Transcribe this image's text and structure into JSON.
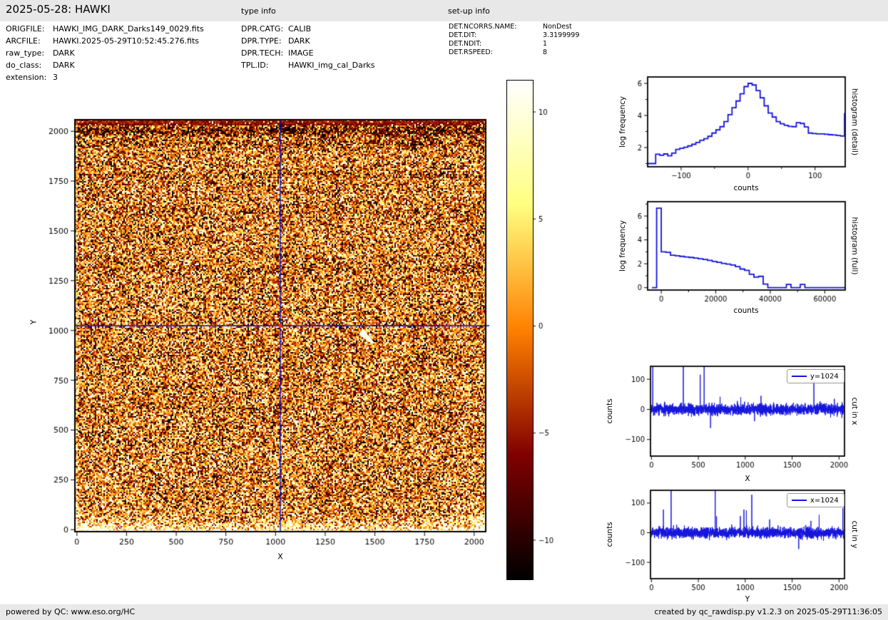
{
  "header": {
    "title": "2025-05-28: HAWKI",
    "type_info_heading": "type info",
    "setup_info_heading": "set-up info"
  },
  "file_info": {
    "rows": [
      {
        "label": "ORIGFILE:",
        "value": "HAWKI_IMG_DARK_Darks149_0029.fits"
      },
      {
        "label": "ARCFILE:",
        "value": "HAWKI.2025-05-29T10:52:45.276.fits"
      },
      {
        "label": "raw_type:",
        "value": "DARK"
      },
      {
        "label": "do_class:",
        "value": "DARK"
      },
      {
        "label": "extension:",
        "value": "3"
      }
    ]
  },
  "type_info": {
    "rows": [
      {
        "label": "DPR.CATG:",
        "value": "CALIB"
      },
      {
        "label": "DPR.TYPE:",
        "value": "DARK"
      },
      {
        "label": "DPR.TECH:",
        "value": "IMAGE"
      },
      {
        "label": "TPL.ID:",
        "value": "HAWKI_img_cal_Darks"
      }
    ]
  },
  "setup_info": {
    "rows": [
      {
        "label": "DET.NCORRS.NAME:",
        "value": "NonDest"
      },
      {
        "label": "DET.DIT:",
        "value": "3.3199999"
      },
      {
        "label": "DET.NDIT:",
        "value": "1"
      },
      {
        "label": "DET.RSPEED:",
        "value": "8"
      }
    ]
  },
  "footer": {
    "left": "powered by QC: www.eso.org/HC",
    "right": "created by qc_rawdisp.py v1.2.3 on 2025-05-29T11:36:05"
  },
  "colors": {
    "line_blue": "#1414dc",
    "crosshair_blue": "#0000cd",
    "marker_red": "#f03000",
    "header_bg": "#e8e8e8",
    "footer_bg": "#e9e9e9",
    "streak_white": "#fffdf2"
  },
  "chart_data": [
    {
      "id": "main_image",
      "type": "heatmap",
      "xlabel": "X",
      "ylabel": "Y",
      "xlim": [
        -10,
        2058
      ],
      "ylim": [
        -10,
        2058
      ],
      "xticks_major": [
        0,
        250,
        500,
        750,
        1000,
        1250,
        1500,
        1750,
        2000
      ],
      "yticks_major": [
        0,
        250,
        500,
        750,
        1000,
        1250,
        1500,
        1750,
        2000
      ],
      "colormap": "afmhot",
      "vmin": -11.8,
      "vmax": 11.5,
      "crosshair": {
        "x": 1024,
        "y": 1024
      },
      "streak": {
        "x": 1460,
        "y": 965
      },
      "description": "2048x2048 HAWKI dark frame: orange/red speckle noise, dark band at top rows, bright white band at bottom rows curving up in corners, blue crosshair lines at x=1024 and y=1024 with red marker, white cosmic-ray streak near (1460,965)"
    },
    {
      "id": "colorbar",
      "type": "colorbar",
      "vmin": -11.8,
      "vmax": 11.5,
      "ticks": [
        10,
        5,
        0,
        -5,
        -10
      ]
    },
    {
      "id": "histogram_detail",
      "type": "bar",
      "side_label": "histogram (detail)",
      "xlabel": "counts",
      "ylabel": "log frequency",
      "xlim": [
        -150,
        145
      ],
      "ylim": [
        0.8,
        6.4
      ],
      "xticks_major": [
        -100,
        0,
        100
      ],
      "xticks_minor": [
        -50,
        50
      ],
      "yticks_major": [
        2,
        4,
        6
      ],
      "yticks_minor": [
        1,
        3,
        5
      ],
      "x_start": -150,
      "bin_width": 6,
      "values": [
        1.0,
        1.0,
        1.58,
        1.52,
        1.6,
        1.48,
        1.65,
        1.88,
        1.95,
        2.02,
        2.1,
        2.2,
        2.32,
        2.45,
        2.55,
        2.7,
        2.9,
        3.1,
        3.3,
        3.62,
        4.05,
        4.48,
        4.9,
        5.35,
        5.8,
        6.0,
        5.9,
        5.55,
        5.1,
        4.6,
        4.15,
        3.9,
        3.62,
        3.48,
        3.38,
        3.32,
        3.3,
        3.55,
        3.5,
        3.28,
        2.9,
        2.87,
        2.85,
        2.85,
        2.83,
        2.8,
        2.78,
        2.75,
        2.72,
        4.1
      ]
    },
    {
      "id": "histogram_full",
      "type": "bar",
      "side_label": "histogram (full)",
      "xlabel": "counts",
      "ylabel": "log frequency",
      "xlim": [
        -5000,
        67500
      ],
      "ylim": [
        -0.2,
        7.2
      ],
      "xticks_major": [
        0,
        20000,
        40000,
        60000
      ],
      "xticks_minor": [
        10000,
        30000,
        50000
      ],
      "yticks_major": [
        0,
        2,
        4,
        6
      ],
      "yticks_minor": [
        1,
        3,
        5,
        7
      ],
      "x_start": -3400,
      "bin_width": 1700,
      "values": [
        0,
        6.65,
        3.0,
        2.95,
        2.72,
        2.67,
        2.62,
        2.57,
        2.53,
        2.48,
        2.42,
        2.36,
        2.28,
        2.2,
        2.12,
        2.03,
        1.97,
        1.9,
        1.76,
        1.56,
        1.45,
        1.12,
        0.88,
        0.95,
        0.3,
        0,
        0,
        0,
        0,
        0.27,
        0,
        0,
        0.27,
        0,
        0,
        0,
        0,
        0,
        0,
        0,
        0,
        0
      ]
    },
    {
      "id": "cut_x",
      "type": "line",
      "side_label": "cut in x",
      "legend": "y=1024",
      "xlabel": "X",
      "ylabel": "counts",
      "xlim": [
        -10,
        2058
      ],
      "ylim": [
        -155,
        143
      ],
      "xticks_major": [
        0,
        500,
        1000,
        1500,
        2000
      ],
      "yticks_major": [
        -100,
        0,
        100
      ],
      "noise": {
        "seed": 20240,
        "sigma": 9,
        "n": 2048
      },
      "spikes": [
        [
          14,
          143
        ],
        [
          340,
          143
        ],
        [
          520,
          115
        ],
        [
          562,
          143
        ],
        [
          630,
          -62
        ],
        [
          732,
          42
        ],
        [
          952,
          40
        ],
        [
          1168,
          45
        ],
        [
          1732,
          95
        ],
        [
          1950,
          35
        ]
      ]
    },
    {
      "id": "cut_y",
      "type": "line",
      "side_label": "cut in y",
      "legend": "x=1024",
      "xlabel": "Y",
      "ylabel": "counts",
      "xlim": [
        -10,
        2058
      ],
      "ylim": [
        -155,
        143
      ],
      "xticks_major": [
        0,
        500,
        1000,
        1500,
        2000
      ],
      "yticks_major": [
        -100,
        0,
        100
      ],
      "noise": {
        "seed": 777,
        "sigma": 9,
        "n": 2048
      },
      "spikes": [
        [
          128,
          78
        ],
        [
          210,
          143
        ],
        [
          680,
          143
        ],
        [
          694,
          55
        ],
        [
          948,
          56
        ],
        [
          986,
          78
        ],
        [
          1012,
          75
        ],
        [
          1070,
          128
        ],
        [
          1260,
          45
        ],
        [
          1570,
          -55
        ],
        [
          1700,
          40
        ],
        [
          1788,
          60
        ],
        [
          2040,
          83
        ]
      ]
    }
  ]
}
